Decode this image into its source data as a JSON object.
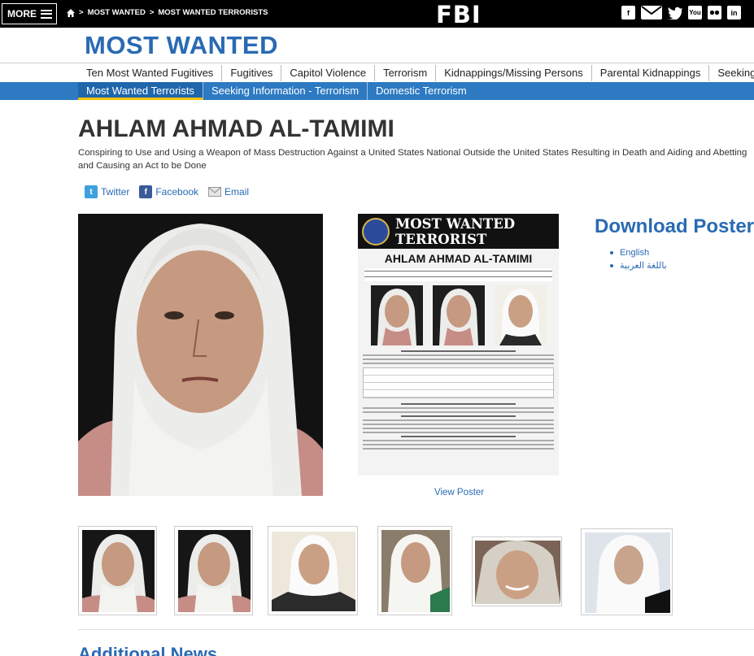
{
  "topbar": {
    "more_label": "MORE",
    "breadcrumb": [
      "MOST WANTED",
      "MOST WANTED TERRORISTS"
    ],
    "logo": "FBI",
    "social_icons": [
      "facebook-icon",
      "email-icon",
      "twitter-icon",
      "youtube-icon",
      "flickr-icon",
      "linkedin-icon"
    ],
    "youtube_text": "You",
    "linkedin_text": "in"
  },
  "section": {
    "title": "MOST WANTED"
  },
  "nav_primary": [
    "Ten Most Wanted Fugitives",
    "Fugitives",
    "Capitol Violence",
    "Terrorism",
    "Kidnappings/Missing Persons",
    "Parental Kidnappings",
    "Seeking"
  ],
  "nav_secondary": [
    {
      "label": "Most Wanted Terrorists",
      "active": true
    },
    {
      "label": "Seeking Information - Terrorism",
      "active": false
    },
    {
      "label": "Domestic Terrorism",
      "active": false
    }
  ],
  "person": {
    "name": "AHLAM AHMAD AL-TAMIMI",
    "charges": "Conspiring to Use and Using a Weapon of Mass Destruction Against a United States National Outside the United States Resulting in Death and Aiding and Abetting and Causing an Act to be Done"
  },
  "share": {
    "twitter": "Twitter",
    "facebook": "Facebook",
    "email": "Email"
  },
  "poster": {
    "header_line1": "MOST WANTED",
    "header_line2": "TERRORIST",
    "name": "AHLAM AHMAD AL-TAMIMI",
    "view_label": "View Poster"
  },
  "download": {
    "title": "Download Poster",
    "links": [
      "English",
      "باللغة العربية"
    ]
  },
  "additional": {
    "title": "Additional News"
  },
  "colors": {
    "brand_blue": "#2a6ab3",
    "nav_blue": "#2d7ac2",
    "active_underline": "#f2c200"
  }
}
